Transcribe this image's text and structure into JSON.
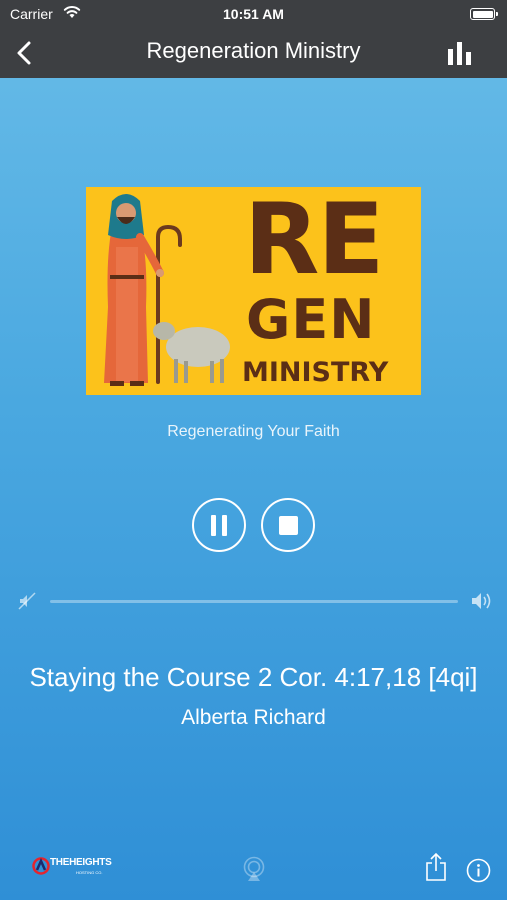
{
  "status_bar": {
    "carrier": "Carrier",
    "time": "10:51 AM"
  },
  "nav": {
    "title": "Regeneration Ministry",
    "back_icon": "chevron-left-icon",
    "right_icon": "equalizer-icon"
  },
  "artwork": {
    "line1": "RE",
    "line2": "GEN",
    "line3": "MINISTRY",
    "background": "#fcc21b",
    "text_color": "#5b2e16"
  },
  "station": {
    "tagline": "Regenerating Your Faith"
  },
  "controls": {
    "pause_icon": "pause-icon",
    "stop_icon": "stop-icon",
    "state": "playing"
  },
  "volume": {
    "min_icon": "volume-mute-icon",
    "max_icon": "volume-up-icon"
  },
  "now_playing": {
    "title": "Staying the Course 2 Cor. 4:17,18 [4qi]",
    "artist": "Alberta Richard"
  },
  "footer": {
    "brand_name": "THEHEIGHTS",
    "brand_sub": "HOSTING CO.",
    "airplay_icon": "airplay-icon",
    "share_icon": "share-icon",
    "info_icon": "info-icon"
  },
  "colors": {
    "bar": "#3d3f42",
    "bg_top": "#68bce8",
    "bg_bottom": "#2f8fd6"
  }
}
